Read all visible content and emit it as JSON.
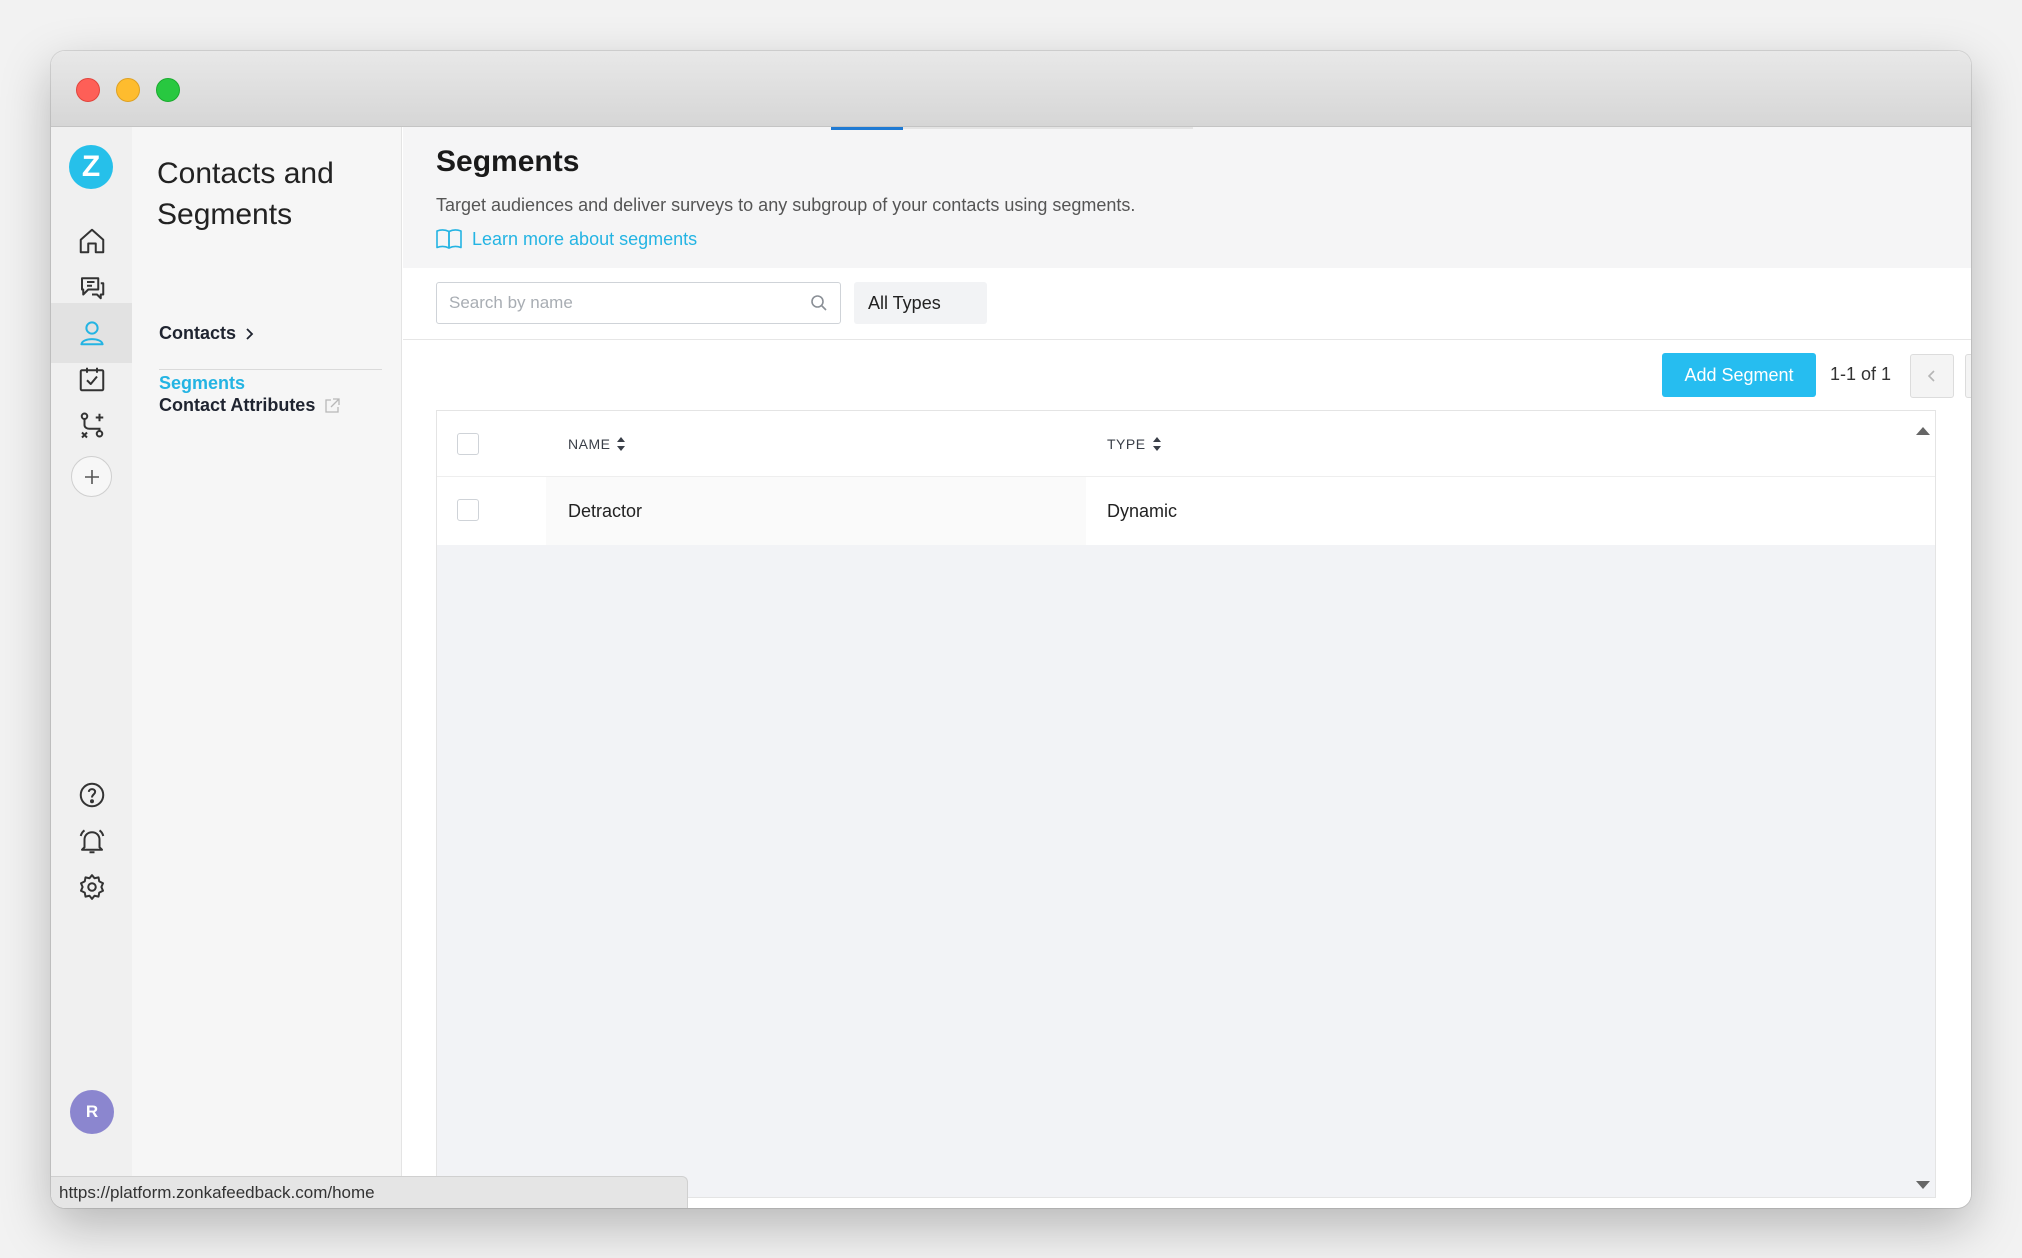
{
  "sidebar_subnav": {
    "title": "Contacts and Segments",
    "items": [
      {
        "label": "Contacts"
      },
      {
        "label": "Segments"
      },
      {
        "label": "Contact Attributes"
      }
    ]
  },
  "rail": {
    "avatar_initial": "R",
    "icons": [
      "zonka-logo-icon",
      "home-icon",
      "surveys-icon",
      "contacts-icon",
      "tasks-icon",
      "workflows-icon",
      "add-icon",
      "help-icon",
      "notifications-icon",
      "settings-icon"
    ]
  },
  "header": {
    "title": "Segments",
    "description": "Target audiences and deliver surveys to any subgroup of your contacts using segments.",
    "learn_more": "Learn more about segments"
  },
  "filters": {
    "search_placeholder": "Search by name",
    "type_selected": "All Types"
  },
  "toolbar": {
    "add_label": "Add Segment",
    "pagination": "1-1 of 1"
  },
  "table": {
    "columns": [
      "NAME",
      "TYPE"
    ],
    "rows": [
      {
        "name": "Detractor",
        "type": "Dynamic"
      }
    ]
  },
  "status_url": "https://platform.zonkafeedback.com/home",
  "colors": {
    "accent": "#24b4e3",
    "button": "#26bdf0"
  }
}
